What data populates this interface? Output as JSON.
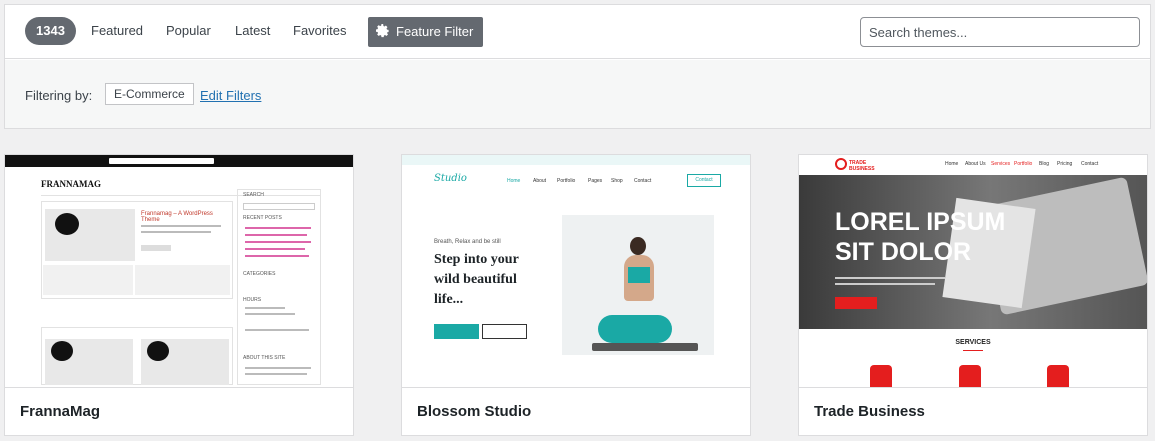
{
  "header": {
    "theme_count": "1343",
    "tabs": [
      "Featured",
      "Popular",
      "Latest",
      "Favorites"
    ],
    "feature_filter_label": "Feature Filter",
    "search_placeholder": "Search themes..."
  },
  "filters": {
    "label": "Filtering by:",
    "active_tag": "E-Commerce",
    "edit_link": "Edit Filters"
  },
  "themes": [
    {
      "name": "FrannaMag",
      "preview": {
        "logo": "FRANNAMAG",
        "featured_title": "Frannamag – A WordPress Theme",
        "sidebar_headings": [
          "SEARCH",
          "RECENT POSTS",
          "CATEGORIES",
          "HOURS",
          "ABOUT THIS SITE"
        ]
      }
    },
    {
      "name": "Blossom Studio",
      "preview": {
        "logo": "Studio",
        "nav": [
          "Home",
          "About",
          "Portfolio",
          "Pages",
          "Shop",
          "Contact"
        ],
        "contact_button": "Contact",
        "kicker": "Breath, Relax and be still",
        "headline": [
          "Step into your",
          "wild beautiful",
          "life..."
        ]
      }
    },
    {
      "name": "Trade Business",
      "preview": {
        "logo": "TRADE BUSINESS",
        "nav": [
          "Home",
          "About Us",
          "Services",
          "Portfolio",
          "Blog",
          "Pricing",
          "Contact"
        ],
        "hero_lines": [
          "LOREL IPSUM",
          "SIT DOLOR"
        ],
        "services_heading": "SERVICES"
      }
    }
  ],
  "colors": {
    "count_badge": "#646970",
    "link": "#2271b1",
    "blossom_accent": "#1aa9a5",
    "trade_accent": "#e41e1e"
  }
}
